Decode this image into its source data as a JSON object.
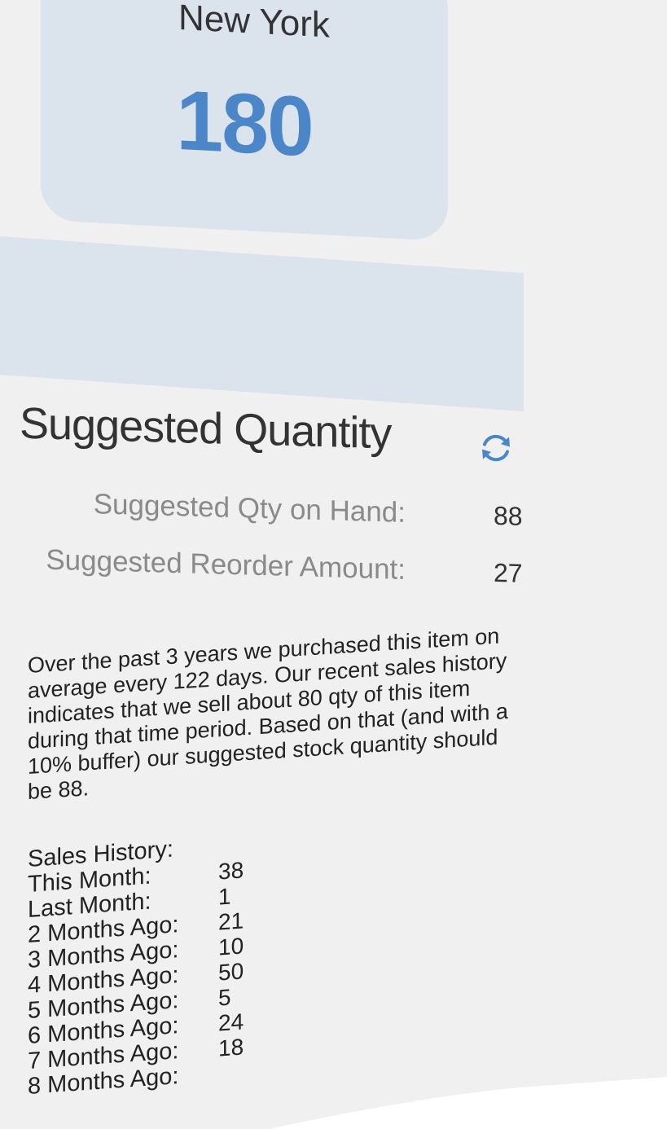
{
  "location": {
    "name": "New York",
    "value": "180"
  },
  "suggested": {
    "title": "Suggested Quantity",
    "refresh_icon": "refresh-icon",
    "rows": [
      {
        "label": "Suggested Qty on Hand:",
        "value": "88"
      },
      {
        "label": "Suggested Reorder Amount:",
        "value": "27"
      }
    ]
  },
  "description": "Over the past 3 years we purchased this item on average every 122 days. Our recent sales history indicates that we sell about 80 qty of this item during that time period. Based on that (and with a 10% buffer) our suggested stock quantity should be 88.",
  "history": {
    "title": "Sales History:",
    "rows": [
      {
        "label": "This Month:",
        "value": ""
      },
      {
        "label": "Last Month:",
        "value": "38"
      },
      {
        "label": "2 Months Ago:",
        "value": "1"
      },
      {
        "label": "3 Months Ago:",
        "value": "21"
      },
      {
        "label": "4 Months Ago:",
        "value": "10"
      },
      {
        "label": "5 Months Ago:",
        "value": "50"
      },
      {
        "label": "6 Months Ago:",
        "value": "5"
      },
      {
        "label": "7 Months Ago:",
        "value": "24"
      },
      {
        "label": "8 Months Ago:",
        "value": "18"
      }
    ]
  },
  "colors": {
    "accent": "#4a86c8",
    "card_bg": "#dbe3ec",
    "page_bg": "#f0f0f0"
  }
}
